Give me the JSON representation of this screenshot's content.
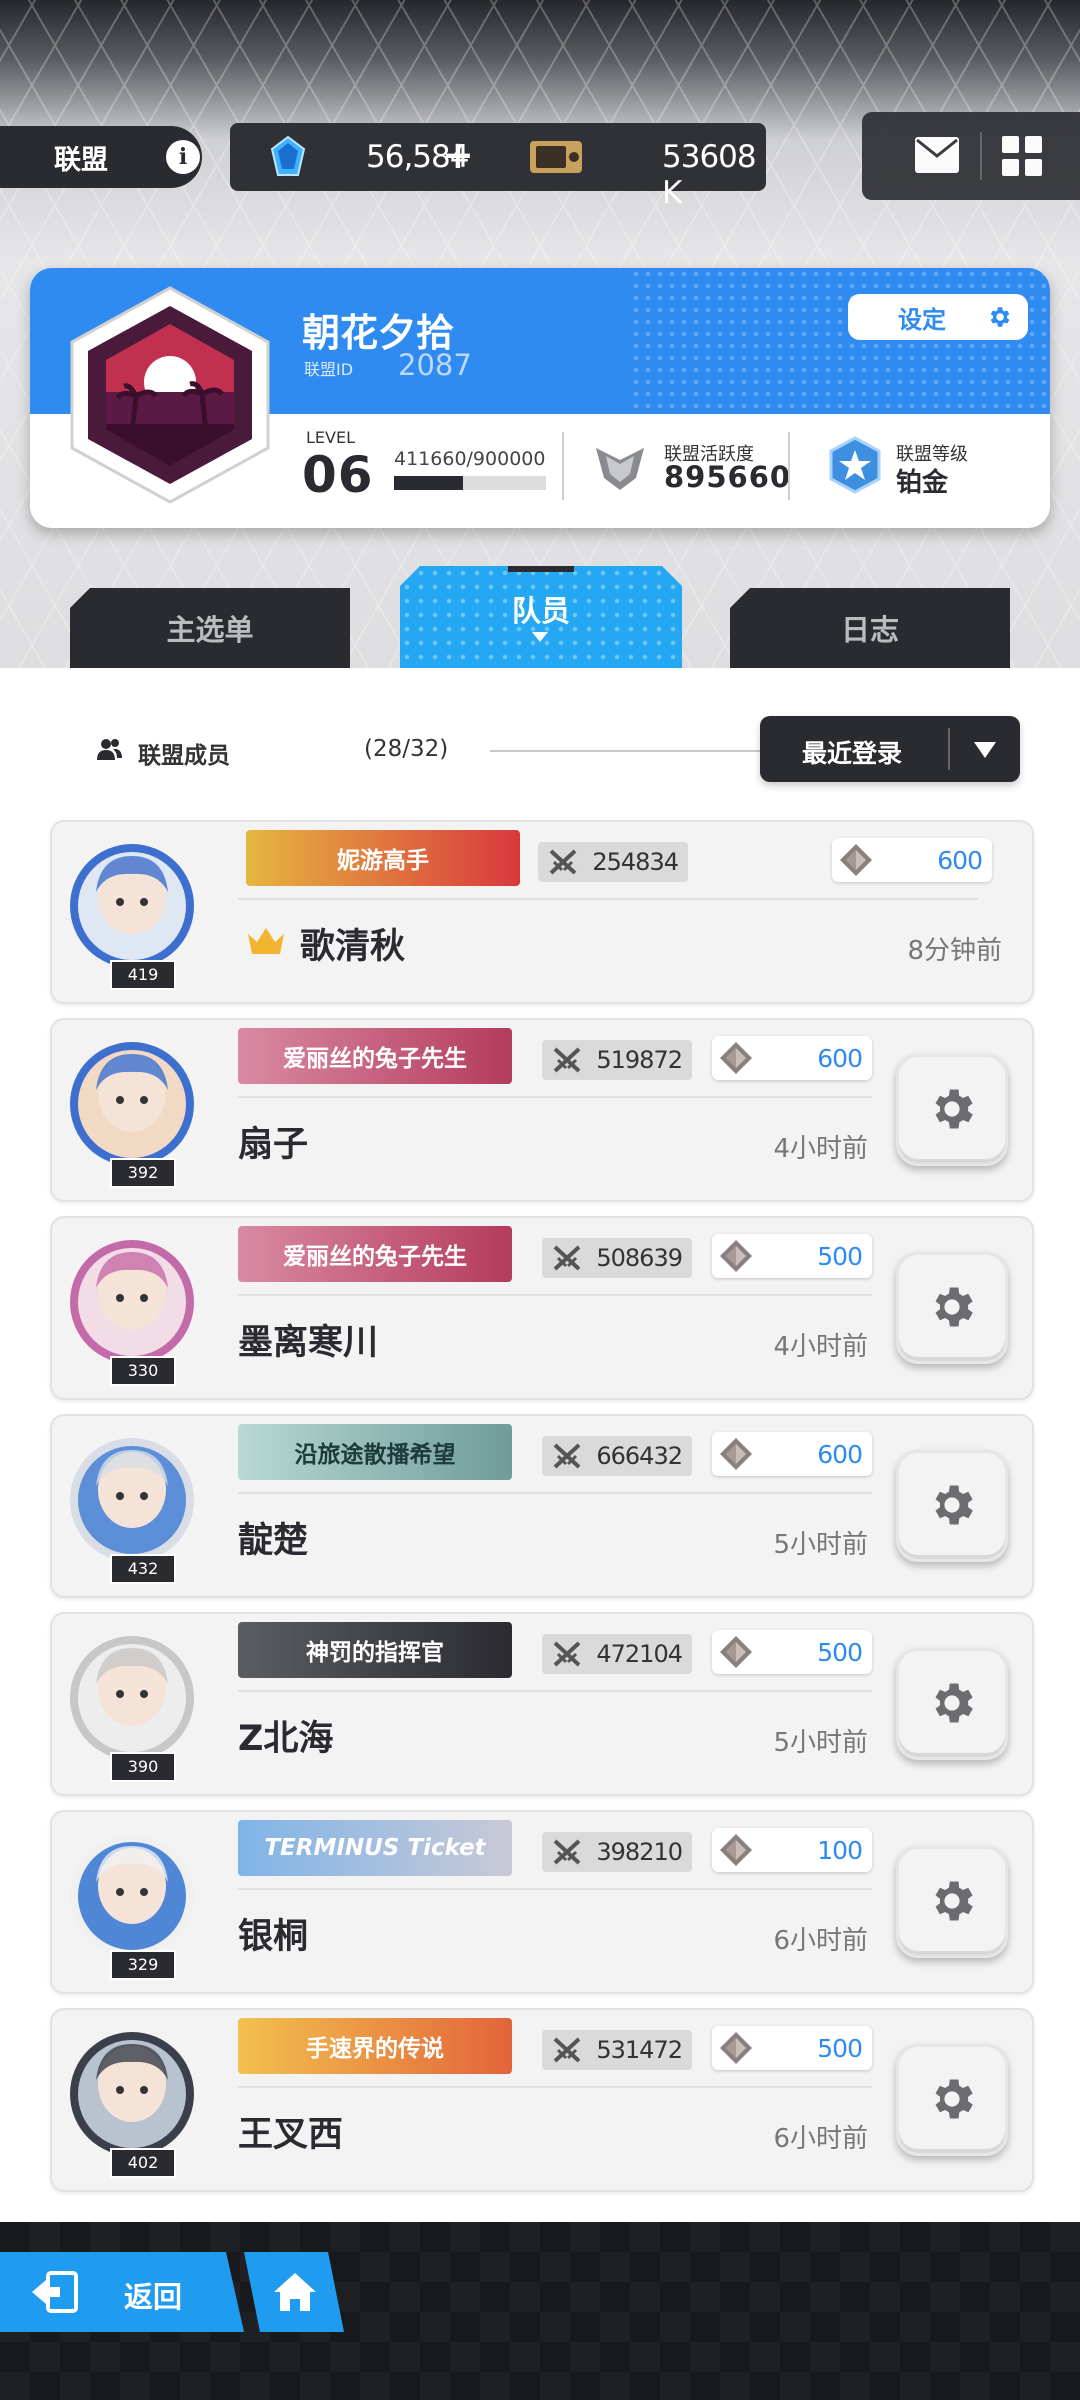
{
  "header": {
    "alliance_tab": "联盟",
    "gems": "56,584",
    "plus": "+",
    "tickets": "53608 K"
  },
  "alliance": {
    "name": "朝花夕拾",
    "id_label": "联盟ID",
    "id": "2087",
    "settings_label": "设定",
    "level_label": "LEVEL",
    "level": "06",
    "exp_text": "411660/900000",
    "exp_progress": 0.457,
    "activity_label": "联盟活跃度",
    "activity": "895660",
    "rank_label": "联盟等级",
    "rank": "铂金"
  },
  "tabs": {
    "main": "主选单",
    "members": "队员",
    "log": "日志"
  },
  "members_section": {
    "label": "联盟成员",
    "count": "(28/32)",
    "sort_label": "最近登录"
  },
  "members": [
    {
      "name": "歌清秋",
      "level": "419",
      "badge": "妮游高手",
      "power": "254834",
      "contribution": "600",
      "time": "8分钟前",
      "leader": true
    },
    {
      "name": "扇子",
      "level": "392",
      "badge": "爱丽丝的兔子先生",
      "power": "519872",
      "contribution": "600",
      "time": "4小时前"
    },
    {
      "name": "墨离寒川",
      "level": "330",
      "badge": "爱丽丝的兔子先生",
      "power": "508639",
      "contribution": "500",
      "time": "4小时前"
    },
    {
      "name": "靛楚",
      "level": "432",
      "badge": "沿旅途散播希望",
      "power": "666432",
      "contribution": "600",
      "time": "5小时前"
    },
    {
      "name": "Z北海",
      "level": "390",
      "badge": "神罚的指挥官",
      "power": "472104",
      "contribution": "500",
      "time": "5小时前"
    },
    {
      "name": "银桐",
      "level": "329",
      "badge": "TERMINUS Ticket",
      "power": "398210",
      "contribution": "100",
      "time": "6小时前"
    },
    {
      "name": "王叉西",
      "level": "402",
      "badge": "手速界的传说",
      "power": "531472",
      "contribution": "500",
      "time": "6小时前"
    }
  ],
  "nav": {
    "back_label": "返回"
  },
  "colors": {
    "accent_blue": "#2f8bf0",
    "dark": "#2a2b30",
    "tab_active": "#24a8f4"
  }
}
